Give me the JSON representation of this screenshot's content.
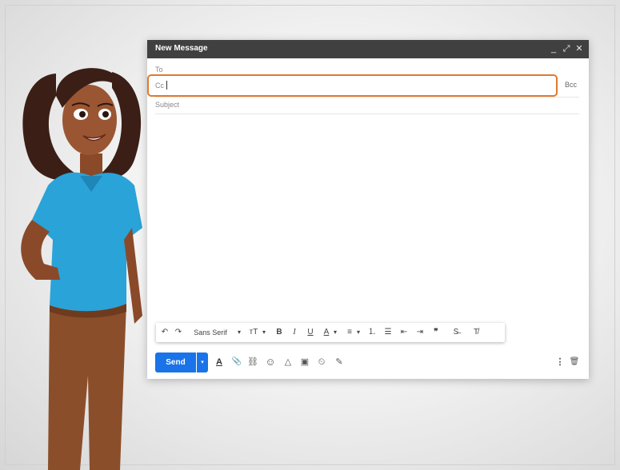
{
  "compose": {
    "title": "New Message",
    "controls": {
      "minimize": "_",
      "expand": "⤢",
      "close": "✕"
    },
    "to_label": "To",
    "cc_label": "Cc",
    "bcc_label": "Bcc",
    "subject_label": "Subject"
  },
  "format_toolbar": {
    "undo": "↶",
    "redo": "↷",
    "font": "Sans Serif",
    "font_arrow": "▾",
    "size": "ᴛT",
    "size_arrow": "▾",
    "bold": "B",
    "italic": "I",
    "underline": "U",
    "text_color": "A",
    "color_arrow": "▾",
    "align": "≡",
    "align_arrow": "▾",
    "numbered_list": "⒈",
    "bulleted_list": "☰",
    "indent_less": "⇤",
    "indent_more": "⇥",
    "quote": "❞",
    "strike": "S̶",
    "clear_format": "T̸"
  },
  "bottom_toolbar": {
    "send_label": "Send",
    "send_options": "▾",
    "icons": {
      "formatting": "A",
      "attach": "📎",
      "link": "⛓",
      "emoji": "☺",
      "drive": "△",
      "photo": "▣",
      "confidential": "⏲",
      "signature": "✎",
      "more": "⋮",
      "trash": "🗑"
    }
  },
  "colors": {
    "title_bar": "#404040",
    "send_blue": "#1a73e8",
    "highlight_orange": "#e07a2e",
    "shirt_blue": "#2aa3d8",
    "pants_brown": "#8a4f2a"
  }
}
